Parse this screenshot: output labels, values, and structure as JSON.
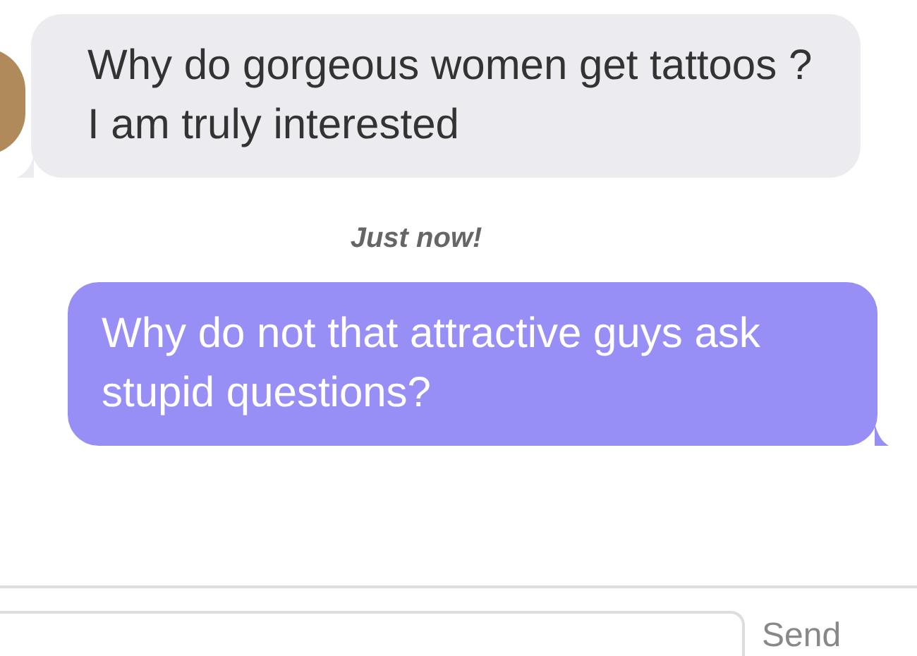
{
  "messages": [
    {
      "kind": "received",
      "text": "Why do gorgeous women get tattoos ? I am truly interested"
    },
    {
      "kind": "timestamp",
      "text": "Just now!"
    },
    {
      "kind": "sent",
      "text": "Why do not that attractive guys ask stupid questions?"
    }
  ],
  "composer": {
    "send": "Send"
  }
}
